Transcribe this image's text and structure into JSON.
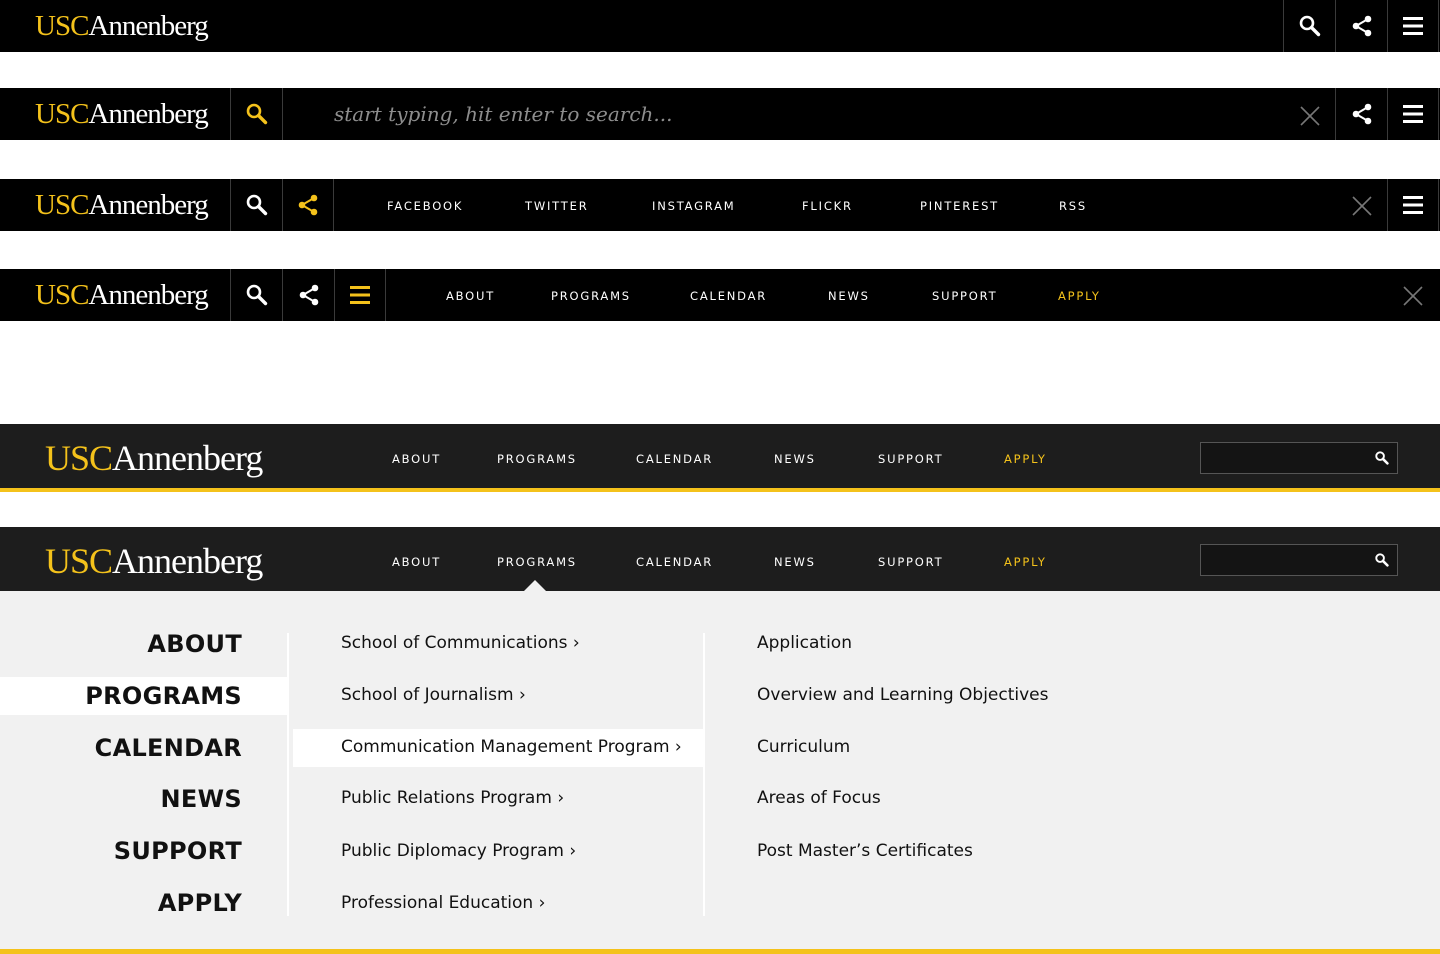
{
  "logo": {
    "usc": "USC",
    "annenberg": "Annenberg"
  },
  "nav": [
    {
      "label": "ABOUT"
    },
    {
      "label": "PROGRAMS"
    },
    {
      "label": "CALENDAR"
    },
    {
      "label": "NEWS"
    },
    {
      "label": "SUPPORT"
    },
    {
      "label": "APPLY"
    }
  ],
  "search": {
    "placeholder": "start typing, hit enter to search..."
  },
  "social": [
    {
      "label": "FACEBOOK"
    },
    {
      "label": "TWITTER"
    },
    {
      "label": "INSTAGRAM"
    },
    {
      "label": "FLICKR"
    },
    {
      "label": "PINTEREST"
    },
    {
      "label": "RSS"
    }
  ],
  "mega_menu": {
    "primary": [
      "ABOUT",
      "PROGRAMS",
      "CALENDAR",
      "NEWS",
      "SUPPORT",
      "APPLY"
    ],
    "selected_primary": "PROGRAMS",
    "programs": [
      "School of Communications ›",
      "School of Journalism ›",
      "Communication Management Program ›",
      "Public Relations Program ›",
      "Public Diplomacy Program ›",
      "Professional Education ›"
    ],
    "selected_program": "Communication Management Program ›",
    "subitems": [
      "Application",
      "Overview and Learning Objectives",
      "Curriculum",
      "Areas of Focus",
      "Post Master’s Certificates"
    ]
  },
  "colors": {
    "gold": "#f4c21b",
    "black": "#000000",
    "dark": "#1d1d1d",
    "panel": "#f1f1f1"
  },
  "icons": [
    "search-icon",
    "share-icon",
    "menu-icon",
    "close-icon"
  ]
}
